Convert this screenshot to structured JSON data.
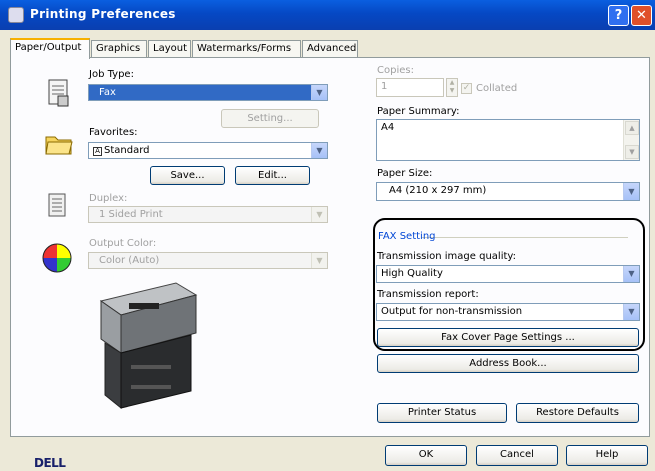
{
  "window": {
    "title": "Printing Preferences"
  },
  "tabs": [
    "Paper/Output",
    "Graphics",
    "Layout",
    "Watermarks/Forms",
    "Advanced"
  ],
  "job_type": {
    "label": "Job Type:",
    "value": "Fax",
    "setting_button": "Setting..."
  },
  "favorites": {
    "label": "Favorites:",
    "value": "Standard",
    "save_button": "Save...",
    "edit_button": "Edit..."
  },
  "duplex": {
    "label": "Duplex:",
    "value": "1 Sided Print"
  },
  "output_color": {
    "label": "Output Color:",
    "value": "Color (Auto)"
  },
  "copies": {
    "label": "Copies:",
    "value": "1",
    "collated_label": "Collated"
  },
  "paper_summary": {
    "label": "Paper Summary:",
    "value": "A4"
  },
  "paper_size": {
    "label": "Paper Size:",
    "value": "A4 (210 x 297 mm)"
  },
  "fax_setting": {
    "group_label": "FAX Setting",
    "image_quality_label": "Transmission image quality:",
    "image_quality_value": "High Quality",
    "report_label": "Transmission report:",
    "report_value": "Output for non-transmission",
    "cover_button": "Fax Cover Page Settings ..."
  },
  "address_book_button": "Address Book...",
  "printer_status_button": "Printer Status",
  "restore_defaults_button": "Restore Defaults",
  "brand": "DELL",
  "footer": {
    "ok": "OK",
    "cancel": "Cancel",
    "help": "Help"
  }
}
